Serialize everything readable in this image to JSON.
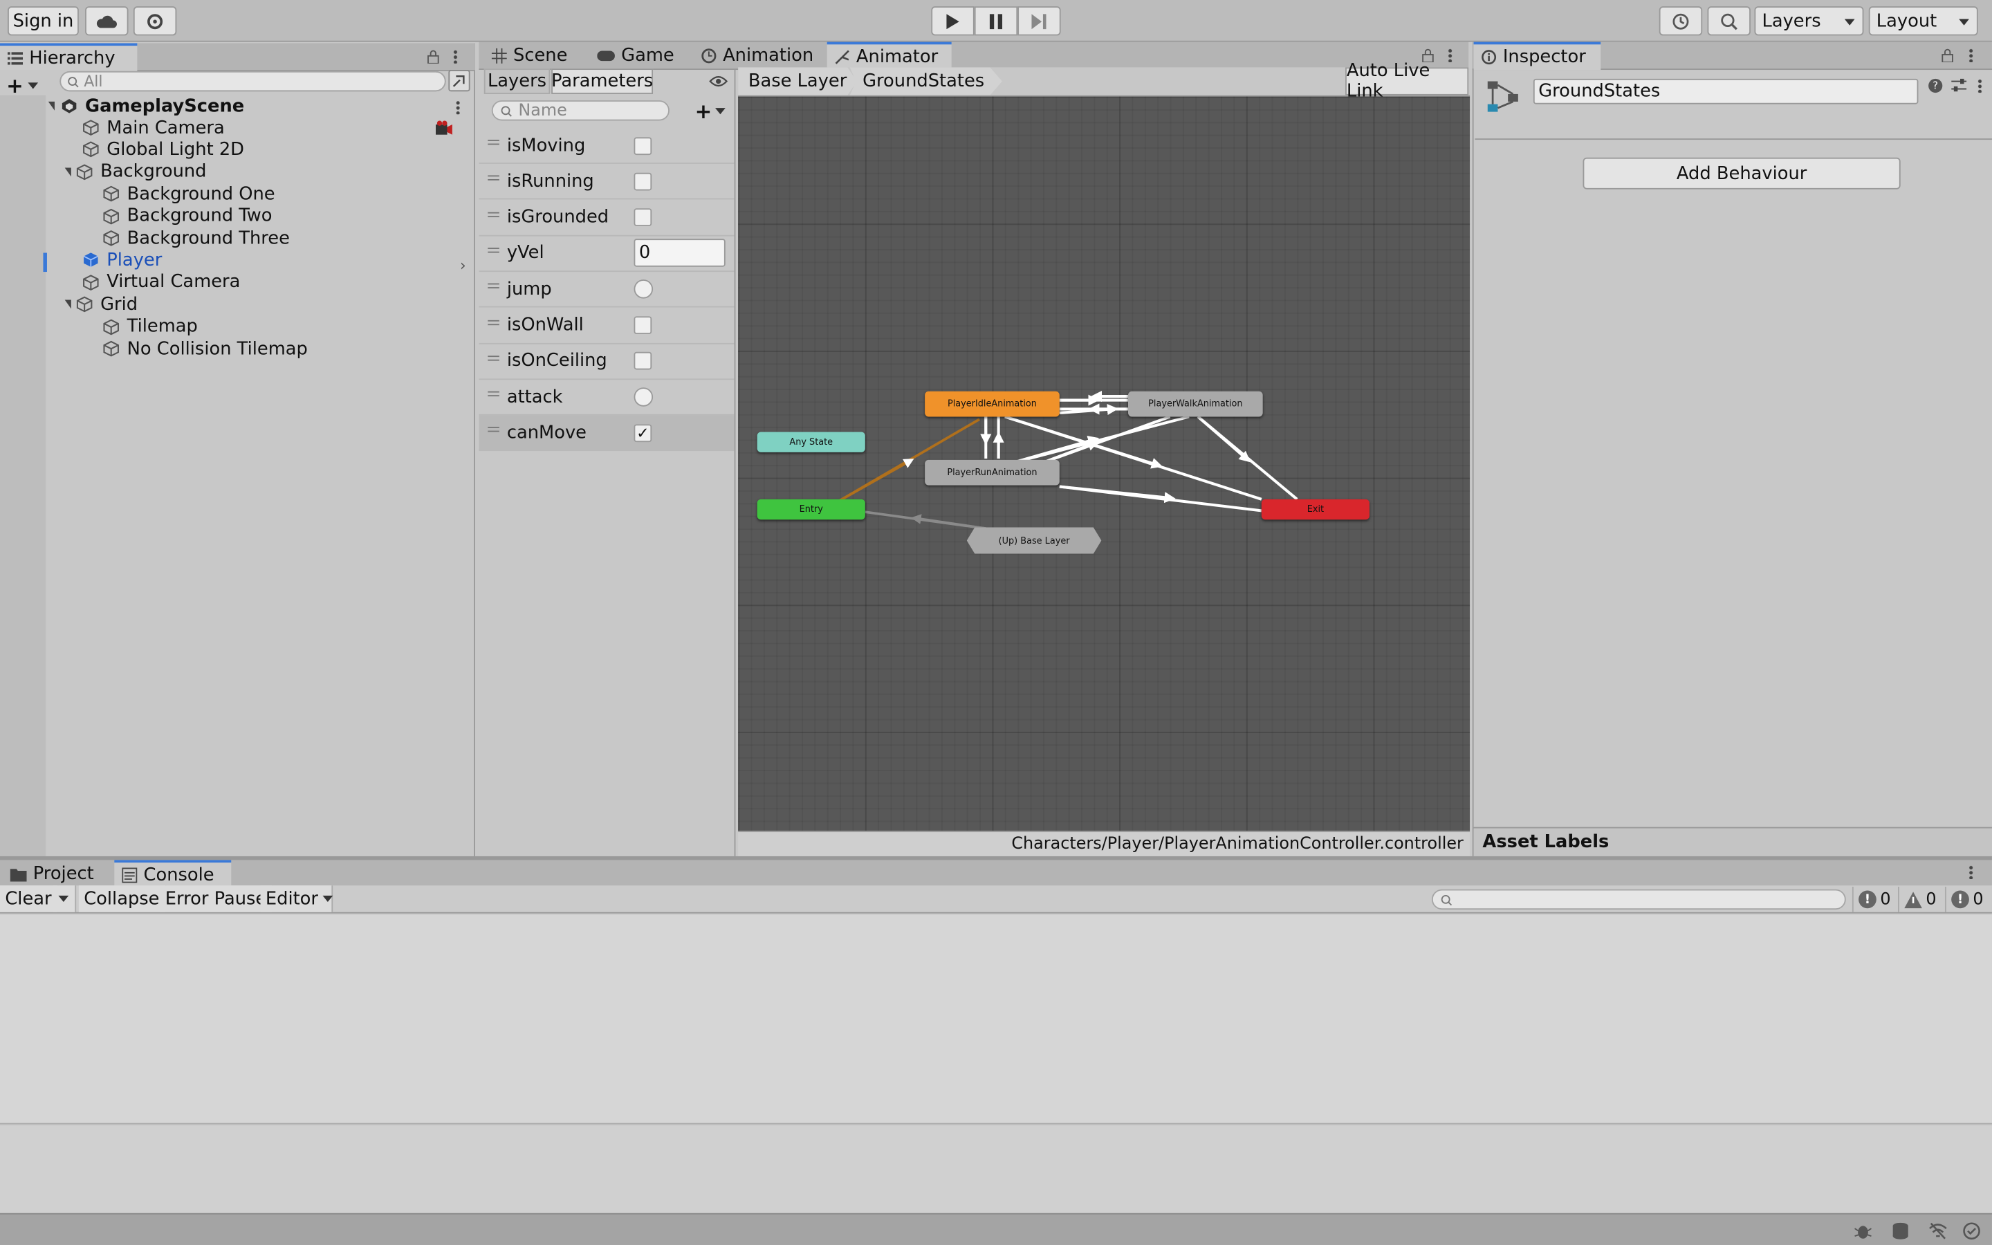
{
  "toolbar": {
    "sign_in": "Sign in",
    "layers_dropdown": "Layers",
    "layout_dropdown": "Layout"
  },
  "hierarchy": {
    "tab_label": "Hierarchy",
    "search_placeholder": "All",
    "scene_name": "GameplayScene",
    "items": [
      {
        "label": "Main Camera",
        "depth": 1
      },
      {
        "label": "Global Light 2D",
        "depth": 1
      },
      {
        "label": "Background",
        "depth": 1,
        "expanded": true
      },
      {
        "label": "Background One",
        "depth": 2
      },
      {
        "label": "Background Two",
        "depth": 2
      },
      {
        "label": "Background Three",
        "depth": 2
      },
      {
        "label": "Player",
        "depth": 1,
        "prefab": true
      },
      {
        "label": "Virtual Camera",
        "depth": 1
      },
      {
        "label": "Grid",
        "depth": 1,
        "expanded": true
      },
      {
        "label": "Tilemap",
        "depth": 2
      },
      {
        "label": "No Collision Tilemap",
        "depth": 2
      }
    ]
  },
  "center_tabs": [
    "Scene",
    "Game",
    "Animation",
    "Animator"
  ],
  "animator": {
    "subtabs": [
      "Layers",
      "Parameters"
    ],
    "param_search_placeholder": "Name",
    "parameters": [
      {
        "name": "isMoving",
        "type": "bool",
        "value": false
      },
      {
        "name": "isRunning",
        "type": "bool",
        "value": false
      },
      {
        "name": "isGrounded",
        "type": "bool",
        "value": false
      },
      {
        "name": "yVel",
        "type": "float",
        "value": "0"
      },
      {
        "name": "jump",
        "type": "trigger",
        "value": false
      },
      {
        "name": "isOnWall",
        "type": "bool",
        "value": false
      },
      {
        "name": "isOnCeiling",
        "type": "bool",
        "value": false
      },
      {
        "name": "attack",
        "type": "trigger",
        "value": false
      },
      {
        "name": "canMove",
        "type": "bool",
        "value": true
      }
    ],
    "breadcrumb": [
      "Base Layer",
      "GroundStates"
    ],
    "auto_live_link": "Auto Live Link",
    "nodes": {
      "idle": "PlayerIdleAnimation",
      "walk": "PlayerWalkAnimation",
      "run": "PlayerRunAnimation",
      "any": "Any State",
      "entry": "Entry",
      "exit": "Exit",
      "up": "(Up) Base Layer"
    },
    "footer_path": "Characters/Player/PlayerAnimationController.controller",
    "colors": {
      "idle": "#f0922a",
      "entry": "#3fc43f",
      "exit": "#d9262c",
      "any": "#7fd1c2",
      "grey": "#a9a9a9"
    }
  },
  "inspector": {
    "tab_label": "Inspector",
    "object_name": "GroundStates",
    "add_behaviour": "Add Behaviour",
    "asset_labels": "Asset Labels"
  },
  "bottom": {
    "tabs": [
      "Project",
      "Console"
    ],
    "console_buttons": [
      "Clear",
      "Collapse",
      "Error Pause",
      "Editor"
    ],
    "counts": {
      "log": "0",
      "warn": "0",
      "error": "0"
    }
  }
}
